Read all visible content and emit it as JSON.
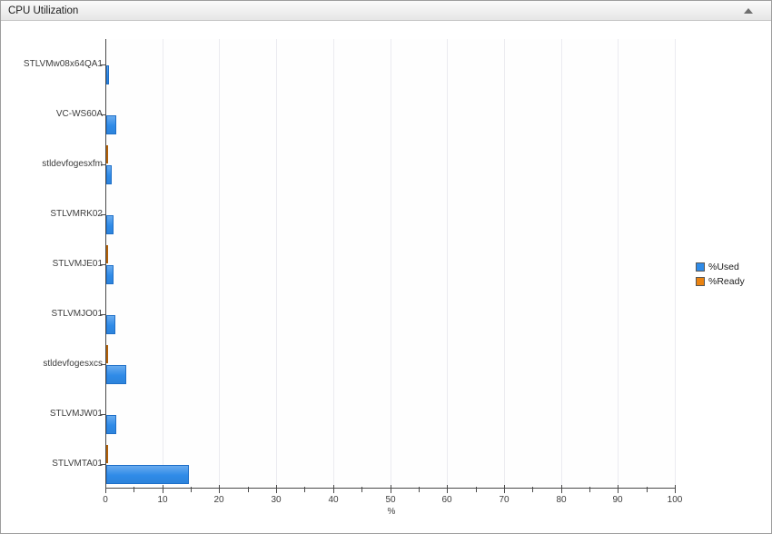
{
  "panel": {
    "title": "CPU Utilization",
    "collapse_icon": "collapse-up-arrow"
  },
  "legend": {
    "position": "right",
    "items": [
      {
        "label": "%Used",
        "color": "#2f8be8"
      },
      {
        "label": "%Ready",
        "color": "#ea8311"
      }
    ]
  },
  "chart_data": {
    "type": "bar",
    "orientation": "horizontal",
    "title": "CPU Utilization",
    "xlabel": "%",
    "ylabel": "",
    "xlim": [
      0,
      100
    ],
    "x_major_ticks": [
      0,
      10,
      20,
      30,
      40,
      50,
      60,
      70,
      80,
      90,
      100
    ],
    "x_minor_step": 5,
    "grid": true,
    "legend_position": "right",
    "categories": [
      "STLVMw08x64QA1",
      "VC-WS60A",
      "stldevfogesxfm",
      "STLVMRK02",
      "STLVMJE01",
      "STLVMJO01",
      "stldevfogesxcs",
      "STLVMJW01",
      "STLVMTA01"
    ],
    "series": [
      {
        "name": "%Used",
        "color": "#2f8be8",
        "color_light": "#5aa4f1",
        "border": "#1e6fc8",
        "values": [
          0.5,
          1.7,
          1.0,
          1.3,
          1.3,
          1.6,
          3.5,
          1.8,
          14.5
        ]
      },
      {
        "name": "%Ready",
        "color": "#ea8311",
        "border": "#b05f07",
        "values": [
          0,
          0,
          0.2,
          0,
          0.15,
          0,
          0.2,
          0,
          0.25
        ]
      }
    ]
  }
}
